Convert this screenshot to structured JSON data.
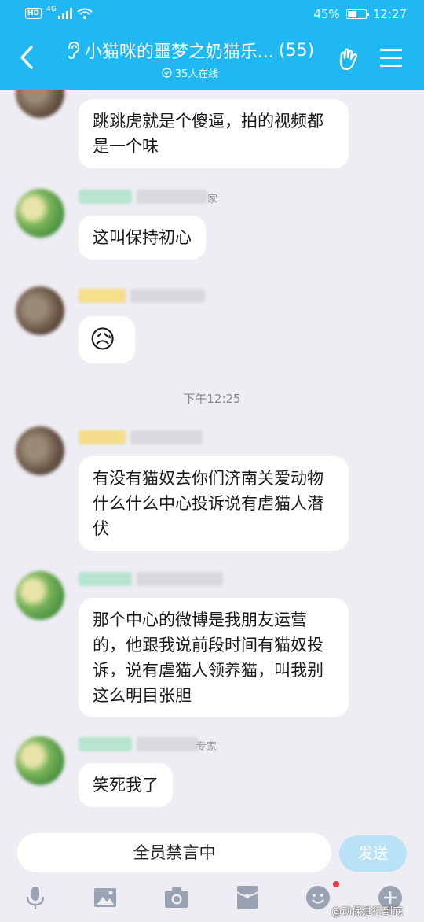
{
  "status_bar": {
    "network": "HD",
    "carrier_tag": "4G",
    "battery": "45%",
    "battery_level": 0.45,
    "time": "12:27"
  },
  "header": {
    "title": "小猫咪的噩梦之奶猫乐...",
    "member_count": "(55)",
    "online": "35人在线"
  },
  "messages": [
    {
      "avatar": "brown",
      "nick_suffix": "",
      "text": "跳跳虎就是个傻逼，拍的视频都是一个味"
    },
    {
      "avatar": "green",
      "nick_suffix": "家",
      "text": "这叫保持初心"
    },
    {
      "avatar": "brown",
      "nick_suffix": "",
      "emoji": "😥"
    },
    {
      "avatar": "brown",
      "nick_suffix": "",
      "text": "有没有猫奴去你们济南关爱动物什么什么中心投诉说有虐猫人潜伏"
    },
    {
      "avatar": "green",
      "nick_suffix": "",
      "text": "那个中心的微博是我朋友运营的，他跟我说前段时间有猫奴投诉，说有虐猫人领养猫，叫我别这么明目张胆"
    },
    {
      "avatar": "green",
      "nick_suffix": "专家",
      "text": "笑死我了"
    }
  ],
  "timestamp": "下午12:25",
  "input": {
    "mute_text": "全员禁言中",
    "send_label": "发送"
  },
  "toolbar": [
    "microphone-icon",
    "image-icon",
    "camera-icon",
    "red-packet-icon",
    "emoji-icon",
    "plus-icon"
  ],
  "watermark": "@动保进行到底"
}
